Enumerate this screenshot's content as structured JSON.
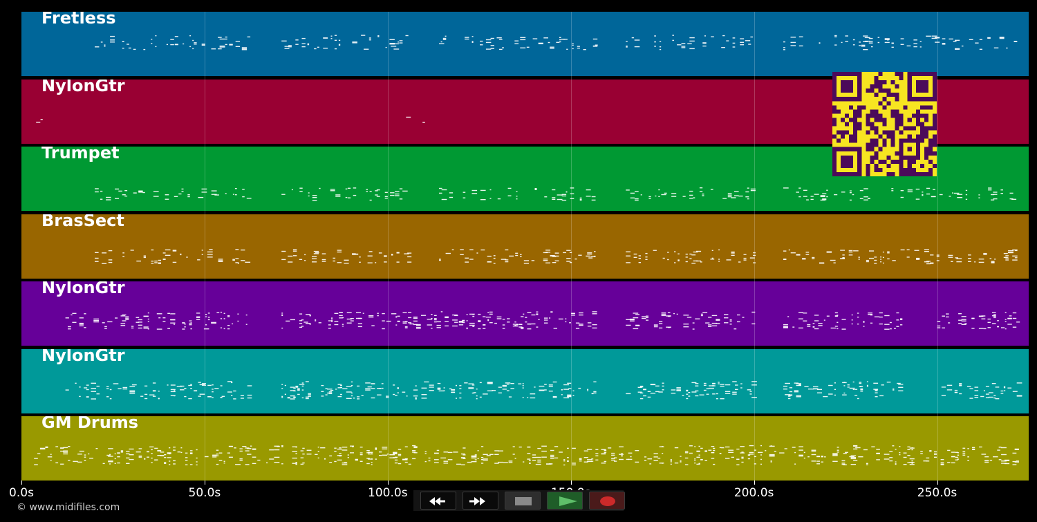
{
  "window": {
    "title": ""
  },
  "tracks": [
    {
      "name": "Fretless",
      "color": "#006699",
      "density": "medium",
      "pitch_level": 0.68
    },
    {
      "name": "NylonGtr",
      "color": "#990033",
      "density": "sparse",
      "pitch_level": 0.55
    },
    {
      "name": "Trumpet",
      "color": "#009933",
      "density": "light",
      "pitch_level": 0.42
    },
    {
      "name": "BrasSect",
      "color": "#996600",
      "density": "medium",
      "pitch_level": 0.5
    },
    {
      "name": "NylonGtr",
      "color": "#660099",
      "density": "dense",
      "pitch_level": 0.55
    },
    {
      "name": "NylonGtr",
      "color": "#009999",
      "density": "dense",
      "pitch_level": 0.52
    },
    {
      "name": "GM Drums",
      "color": "#999900",
      "density": "verydense",
      "pitch_level": 0.55
    }
  ],
  "timeline": {
    "unit": "s",
    "min": 0,
    "max": 275,
    "ticks": [
      {
        "value": 0,
        "label": "0.0s"
      },
      {
        "value": 50,
        "label": "50.0s"
      },
      {
        "value": 100,
        "label": "100.0s"
      },
      {
        "value": 150,
        "label": "150.0s"
      },
      {
        "value": 200,
        "label": "200.0s"
      },
      {
        "value": 250,
        "label": "250.0s"
      }
    ]
  },
  "transport": {
    "rewind_icon": "rewind-icon",
    "fast_forward_icon": "fast-forward-icon",
    "stop_icon": "stop-icon",
    "play_icon": "play-icon",
    "record_icon": "record-icon",
    "colors": {
      "play": "#5fbf6a",
      "record": "#cc2a2a",
      "stop": "#8a8a8a"
    }
  },
  "qr_code": {
    "foreground": "#4b0a5a",
    "background": "#f7e521"
  },
  "footer": {
    "copyright": "© www.midifiles.com"
  }
}
